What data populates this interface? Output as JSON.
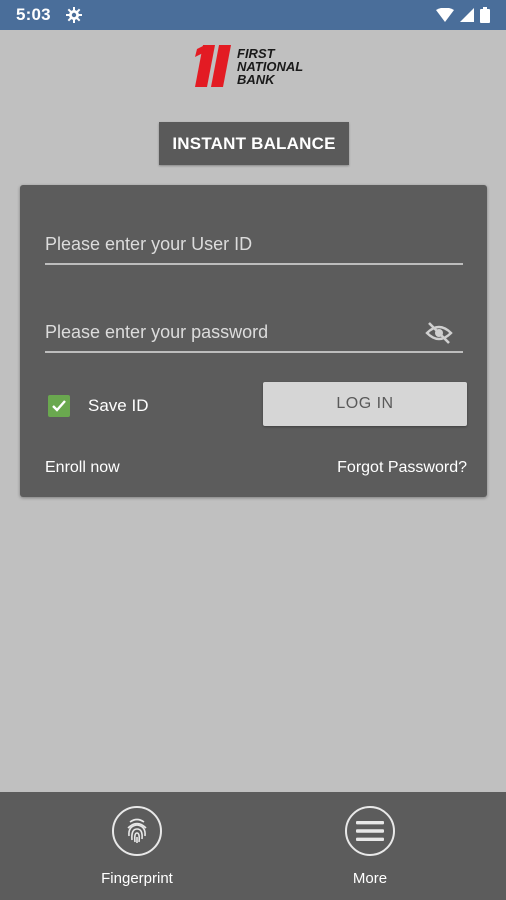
{
  "status_bar": {
    "time": "5:03",
    "icons": [
      "gear-icon",
      "wifi-icon",
      "signal-icon",
      "battery-icon"
    ],
    "color": "#4a6e9a"
  },
  "logo": {
    "line1": "FIRST",
    "line2": "NATIONAL",
    "line3": "BANK",
    "brand_color": "#e31b23"
  },
  "instant_balance": {
    "label": "INSTANT BALANCE"
  },
  "login": {
    "user_id_placeholder": "Please enter your User ID",
    "password_placeholder": "Please enter your password",
    "save_id_label": "Save ID",
    "save_id_checked": true,
    "login_label": "LOG IN",
    "enroll_label": "Enroll now",
    "forgot_label": "Forgot Password?",
    "accent": "#6aa84f"
  },
  "bottom_nav": {
    "fingerprint_label": "Fingerprint",
    "more_label": "More"
  }
}
